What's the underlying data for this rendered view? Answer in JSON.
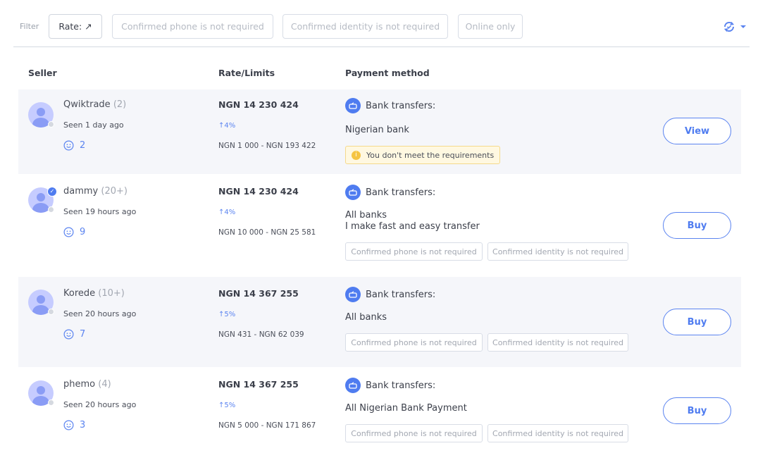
{
  "filters": {
    "label": "Filter",
    "rate_label": "Rate: ↗",
    "chips": [
      "Confirmed phone is not required",
      "Confirmed identity is not required",
      "Online only"
    ],
    "sync_icon": "refresh-check-icon"
  },
  "columns": {
    "seller": "Seller",
    "rate": "Rate/Limits",
    "payment": "Payment method"
  },
  "colors": {
    "accent": "#4f7cf0",
    "row_shade": "#f5f6fa",
    "warning_bg": "#fff8e1"
  },
  "offers": [
    {
      "name": "Qwiktrade",
      "count": "(2)",
      "verified": false,
      "seen": "Seen 1 day ago",
      "rating": "2",
      "rate": "NGN 14 230 424",
      "pct": "↑4%",
      "limits": "NGN 1 000 - NGN 193 422",
      "method": "Bank transfers:",
      "desc": [
        "Nigerian bank"
      ],
      "warning": "You don't meet the requirements",
      "tags": [],
      "action": "View"
    },
    {
      "name": "dammy",
      "count": "(20+)",
      "verified": true,
      "seen": "Seen 19 hours ago",
      "rating": "9",
      "rate": "NGN 14 230 424",
      "pct": "↑4%",
      "limits": "NGN 10 000 - NGN 25 581",
      "method": "Bank transfers:",
      "desc": [
        "All banks",
        "I make fast and easy transfer"
      ],
      "warning": null,
      "tags": [
        "Confirmed phone is not required",
        "Confirmed identity is not required"
      ],
      "action": "Buy"
    },
    {
      "name": "Korede",
      "count": "(10+)",
      "verified": false,
      "seen": "Seen 20 hours ago",
      "rating": "7",
      "rate": "NGN 14 367 255",
      "pct": "↑5%",
      "limits": "NGN 431 - NGN 62 039",
      "method": "Bank transfers:",
      "desc": [
        "All banks"
      ],
      "warning": null,
      "tags": [
        "Confirmed phone is not required",
        "Confirmed identity is not required"
      ],
      "action": "Buy"
    },
    {
      "name": "phemo",
      "count": "(4)",
      "verified": false,
      "seen": "Seen 20 hours ago",
      "rating": "3",
      "rate": "NGN 14 367 255",
      "pct": "↑5%",
      "limits": "NGN 5 000 - NGN 171 867",
      "method": "Bank transfers:",
      "desc": [
        "All Nigerian Bank Payment"
      ],
      "warning": null,
      "tags": [
        "Confirmed phone is not required",
        "Confirmed identity is not required"
      ],
      "action": "Buy"
    }
  ]
}
